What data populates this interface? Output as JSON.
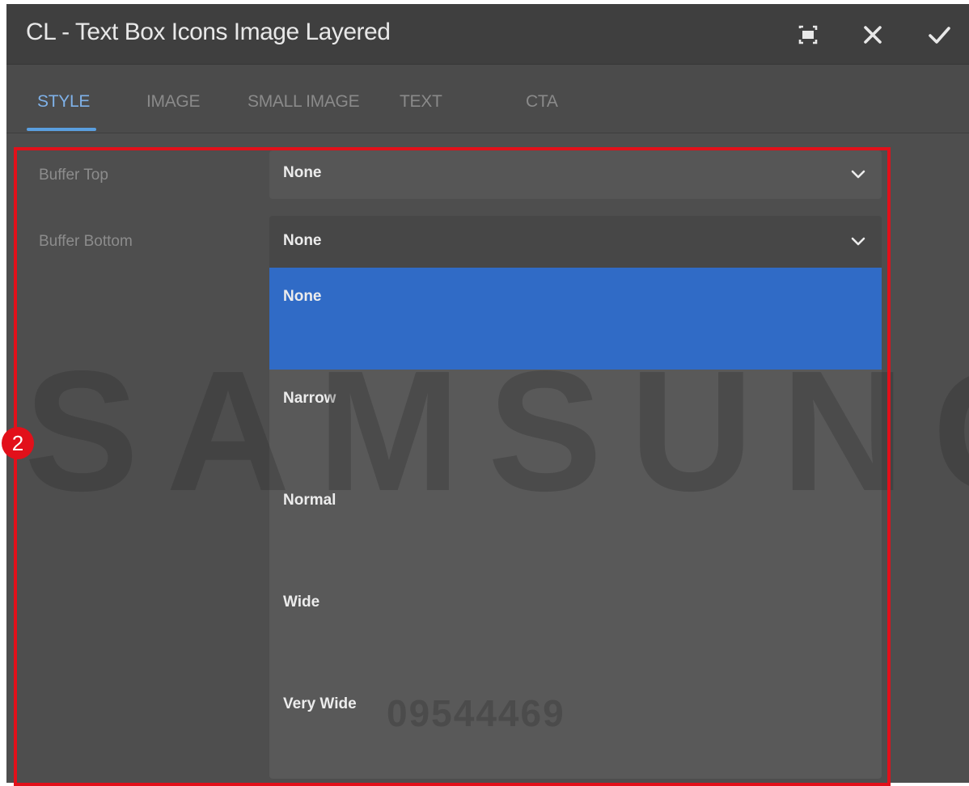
{
  "dialog": {
    "title": "CL - Text Box Icons Image Layered",
    "toolbar": {
      "fullscreen_icon": "fullscreen-icon",
      "close_icon": "close-icon",
      "done_icon": "check-icon"
    }
  },
  "tabs": [
    {
      "label": "STYLE",
      "active": true
    },
    {
      "label": "IMAGE",
      "active": false
    },
    {
      "label": "SMALL IMAGE",
      "active": false
    },
    {
      "label": "TEXT",
      "active": false
    },
    {
      "label": "CTA",
      "active": false
    }
  ],
  "fields": {
    "buffer_top": {
      "label": "Buffer Top",
      "value": "None"
    },
    "buffer_bottom": {
      "label": "Buffer Bottom",
      "value": "None",
      "open": true,
      "options": [
        {
          "label": "None",
          "selected": true
        },
        {
          "label": "Narrow",
          "selected": false
        },
        {
          "label": "Normal",
          "selected": false
        },
        {
          "label": "Wide",
          "selected": false
        },
        {
          "label": "Very Wide",
          "selected": false
        }
      ]
    }
  },
  "annotation": {
    "step": "2",
    "color": "#e2101a"
  },
  "watermark": {
    "brand": "SAMSUNG",
    "code": "09544469"
  },
  "colors": {
    "accent": "#5a9fe0",
    "selected_option": "#306bc6",
    "panel": "#4e4e4e"
  }
}
